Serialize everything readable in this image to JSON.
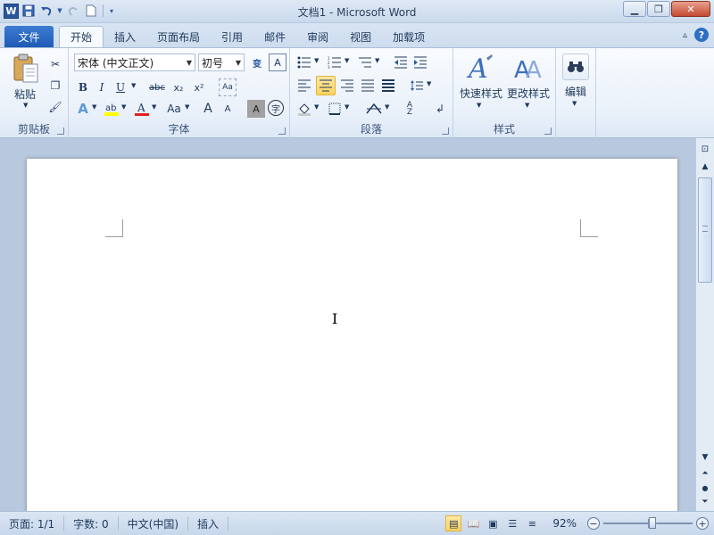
{
  "window": {
    "title": "文档1 - Microsoft Word",
    "app_icon": "W"
  },
  "qat": {
    "icons": [
      "word-icon",
      "save-icon",
      "undo-icon",
      "redo-icon",
      "new-doc-icon",
      "customize-icon"
    ]
  },
  "tabs": {
    "file": "文件",
    "items": [
      "开始",
      "插入",
      "页面布局",
      "引用",
      "邮件",
      "审阅",
      "视图",
      "加载项"
    ],
    "active": "开始"
  },
  "ribbon": {
    "clipboard": {
      "label": "剪贴板",
      "paste": "粘贴"
    },
    "font": {
      "label": "字体",
      "font_name": "宋体 (中文正文)",
      "font_size": "初号",
      "bold": "B",
      "italic": "I",
      "underline": "U",
      "strike": "abc",
      "subscript": "x₂",
      "superscript": "x²",
      "font_color": "A",
      "change_case": "Aa",
      "grow": "A",
      "shrink": "A"
    },
    "paragraph": {
      "label": "段落"
    },
    "styles": {
      "label": "样式",
      "quick_styles": "快速样式",
      "change_styles": "更改样式"
    },
    "editing": {
      "label": "编辑"
    }
  },
  "status": {
    "page": "页面: 1/1",
    "words": "字数: 0",
    "language": "中文(中国)",
    "mode": "插入",
    "zoom": "92%",
    "zoom_level": 0.55
  },
  "colors": {
    "accent": "#2b579a",
    "ribbon_bg": "#eaf1fa",
    "highlight": "#ffd35c"
  }
}
